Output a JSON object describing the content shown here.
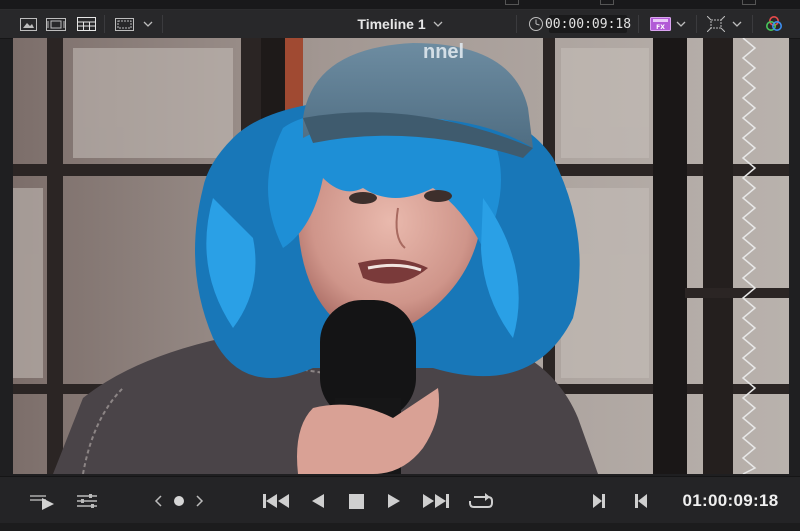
{
  "viewer_header": {
    "timeline_name": "Timeline 1",
    "timeline_dropdown_icon": "chevron-down-icon",
    "source_timecode": "00:00:09:18",
    "left_icons": [
      "image-view-icon",
      "filmstrip-view-icon",
      "grid-view-icon",
      "monitor-frame-icon",
      "chevron-down-icon"
    ],
    "right_icons": [
      "clock-icon",
      "fx-icon",
      "transform-icon",
      "color-wheel-icon"
    ]
  },
  "viewer": {
    "frame_description_icon": "video-frame",
    "cap_text": "nnel"
  },
  "transport": {
    "playhead_timecode": "01:00:09:18",
    "left_icons": [
      "clip-view-play-icon",
      "sliders-icon",
      "prev-icon",
      "dot-icon",
      "next-icon"
    ],
    "center_icons": [
      "skip-to-start-icon",
      "play-reverse-icon",
      "stop-icon",
      "play-icon",
      "skip-to-end-icon",
      "loop-icon"
    ],
    "right_icons": [
      "mark-in-icon",
      "mark-out-icon"
    ]
  },
  "colors": {
    "background": "#1f1f21",
    "toolbar": "#28282a",
    "hair": "#1e8fd6",
    "cap": "#5f7f95"
  }
}
